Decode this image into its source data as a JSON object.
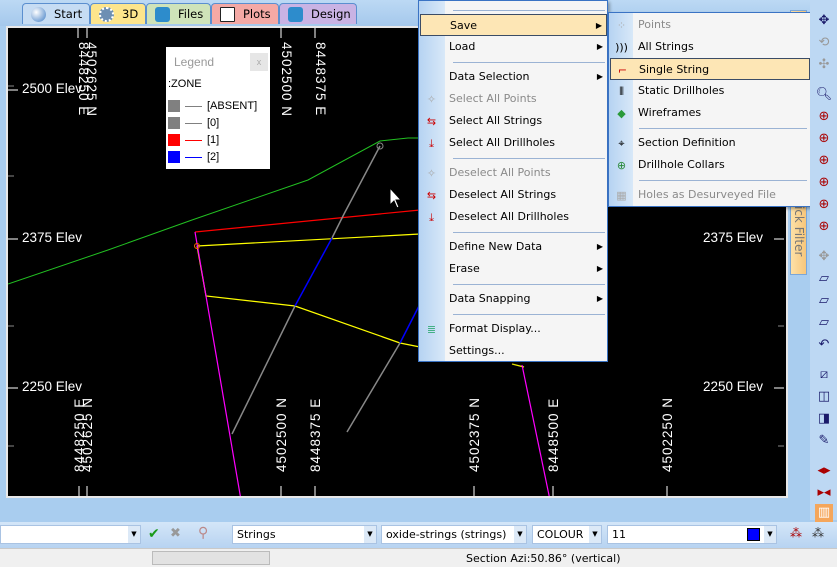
{
  "tabs": [
    {
      "label": "Start",
      "color": "#c6dcf3"
    },
    {
      "label": "3D",
      "color": "#fde58c"
    },
    {
      "label": "Files",
      "color": "#cfe3b9"
    },
    {
      "label": "Plots",
      "color": "#f4a9a5"
    },
    {
      "label": "Design",
      "color": "#c9b3e4"
    }
  ],
  "plot": {
    "elev_labels": {
      "e2500": "2500 Elev",
      "e2375": "2375 Elev",
      "e2250": "2250 Elev"
    },
    "top_coords": [
      "8448250 E",
      "4502625 N",
      "4502500 N",
      "8448375 E"
    ],
    "bottom_coords": [
      "8448250 E",
      "4502625 N",
      "4502500 N",
      "8448375 E",
      "4502375 N",
      "8448500 E",
      "4502250 N"
    ]
  },
  "legend": {
    "title": "Legend",
    "close": "x",
    "field": ":ZONE",
    "items": [
      {
        "label": "[ABSENT]",
        "color": "#808080"
      },
      {
        "label": "[0]",
        "color": "#808080"
      },
      {
        "label": "[1]",
        "color": "#ff0000"
      },
      {
        "label": "[2]",
        "color": "#0000ff"
      }
    ]
  },
  "menu": {
    "items": {
      "save": "Save",
      "load": "Load",
      "data_selection": "Data Selection",
      "select_all_points": "Select All Points",
      "select_all_strings": "Select All Strings",
      "select_all_drillholes": "Select All Drillholes",
      "deselect_all_points": "Deselect All Points",
      "deselect_all_strings": "Deselect All Strings",
      "deselect_all_drillholes": "Deselect All Drillholes",
      "define_new_data": "Define New Data",
      "erase": "Erase",
      "data_snapping": "Data Snapping",
      "format_display": "Format Display...",
      "settings": "Settings..."
    }
  },
  "submenu": {
    "items": {
      "points": "Points",
      "all_strings": "All Strings",
      "single_string": "Single String",
      "static_drillholes": "Static Drillholes",
      "wireframes": "Wireframes",
      "section_definition": "Section Definition",
      "drillhole_collars": "Drillhole Collars",
      "holes_desurveyed": "Holes as Desurveyed File"
    }
  },
  "quick_filter": "ick Filter",
  "toolbar": {
    "data_type": "Strings",
    "file": "oxide-strings (strings)",
    "mode": "COLOUR",
    "value": "11",
    "swatch_color": "#0000ff"
  },
  "status": {
    "section": "Section Azi:50.86° (vertical)"
  }
}
